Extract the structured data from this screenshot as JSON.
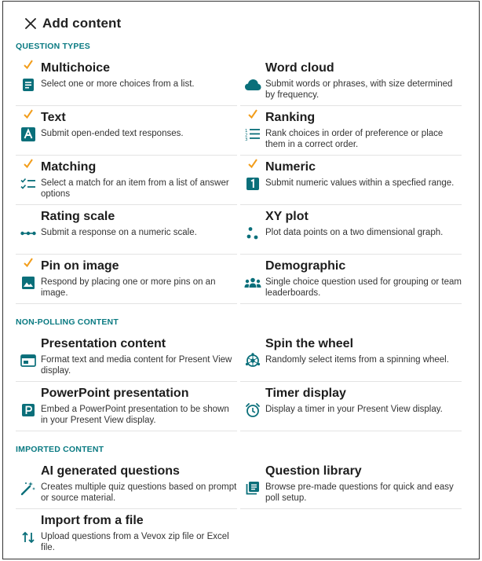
{
  "header": {
    "title": "Add content"
  },
  "colors": {
    "accent": "#0a6f7a",
    "check": "#f29d1b",
    "section": "#0a7a82"
  },
  "sections": {
    "question_types": {
      "title": "QUESTION TYPES"
    },
    "non_polling": {
      "title": "NON-POLLING CONTENT"
    },
    "imported": {
      "title": "IMPORTED CONTENT"
    }
  },
  "items": {
    "multichoice": {
      "title": "Multichoice",
      "desc": "Select one or more choices from a list.",
      "icon": "list-doc-icon",
      "checked": true
    },
    "word_cloud": {
      "title": "Word cloud",
      "desc": "Submit words or phrases, with size determined by frequency.",
      "icon": "cloud-icon",
      "checked": false
    },
    "text": {
      "title": "Text",
      "desc": "Submit open-ended text responses.",
      "icon": "letter-a-icon",
      "checked": true
    },
    "ranking": {
      "title": "Ranking",
      "desc": "Rank choices in order of preference or place them in a correct order.",
      "icon": "ranked-list-icon",
      "checked": true
    },
    "matching": {
      "title": "Matching",
      "desc": "Select a match for an item from a list of answer options",
      "icon": "checklist-icon",
      "checked": true
    },
    "numeric": {
      "title": "Numeric",
      "desc": "Submit numeric values within a specfied range.",
      "icon": "number-one-icon",
      "checked": true
    },
    "rating_scale": {
      "title": "Rating scale",
      "desc": "Submit a response on a numeric scale.",
      "icon": "scale-dots-icon",
      "checked": false
    },
    "xy_plot": {
      "title": "XY plot",
      "desc": "Plot data points on a two dimensional graph.",
      "icon": "scatter-icon",
      "checked": false
    },
    "pin_on_image": {
      "title": "Pin on image",
      "desc": "Respond by placing one or more pins on an image.",
      "icon": "image-icon",
      "checked": true
    },
    "demographic": {
      "title": "Demographic",
      "desc": "Single choice question used for grouping or team leaderboards.",
      "icon": "group-icon",
      "checked": false
    },
    "presentation_content": {
      "title": "Presentation content",
      "desc": "Format text and media content for Present View display.",
      "icon": "window-icon",
      "checked": false
    },
    "spin_wheel": {
      "title": "Spin the wheel",
      "desc": "Randomly select items from a spinning wheel.",
      "icon": "wheel-icon",
      "checked": false
    },
    "powerpoint": {
      "title": "PowerPoint presentation",
      "desc": "Embed a PowerPoint presentation to be shown in your Present View display.",
      "icon": "powerpoint-icon",
      "checked": false
    },
    "timer": {
      "title": "Timer display",
      "desc": "Display a timer in your Present View display.",
      "icon": "alarm-clock-icon",
      "checked": false
    },
    "ai_questions": {
      "title": "AI generated questions",
      "desc": "Creates multiple quiz questions based on prompt or source material.",
      "icon": "magic-wand-icon",
      "checked": false
    },
    "question_library": {
      "title": "Question library",
      "desc": "Browse pre-made questions for quick and easy poll setup.",
      "icon": "library-icon",
      "checked": false
    },
    "import_file": {
      "title": "Import from a file",
      "desc": "Upload questions from a Vevox zip file or Excel file.",
      "icon": "import-arrows-icon",
      "checked": false
    }
  }
}
